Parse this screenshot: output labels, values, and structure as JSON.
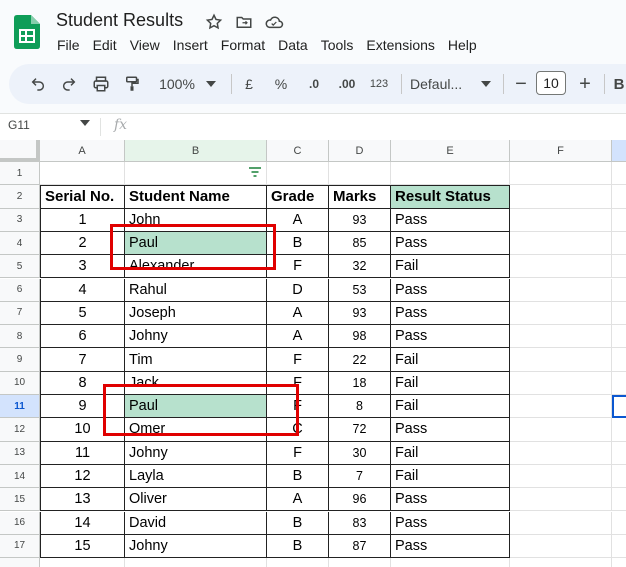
{
  "app": {
    "doc_title": "Student Results",
    "menu": [
      "File",
      "Edit",
      "View",
      "Insert",
      "Format",
      "Data",
      "Tools",
      "Extensions",
      "Help"
    ]
  },
  "toolbar": {
    "zoom": "100%",
    "currency": "£",
    "percent": "%",
    "dec_less": ".0",
    "dec_more": ".00",
    "number_format": "123",
    "font": "Defaul...",
    "font_size": "10",
    "bold": "B"
  },
  "formula_bar": {
    "name_box": "G11",
    "fx": "fx"
  },
  "columns": [
    "A",
    "B",
    "C",
    "D",
    "E",
    "F"
  ],
  "rows": [
    "1",
    "2",
    "3",
    "4",
    "5",
    "6",
    "7",
    "8",
    "9",
    "10",
    "11",
    "12",
    "13",
    "14",
    "15",
    "16",
    "17"
  ],
  "selected_row": "11",
  "table": {
    "headers": [
      "Serial No.",
      "Student Name",
      "Grade",
      "Marks",
      "Result Status"
    ],
    "data": [
      [
        "1",
        "John",
        "A",
        "93",
        "Pass"
      ],
      [
        "2",
        "Paul",
        "B",
        "85",
        "Pass"
      ],
      [
        "3",
        "Alexander",
        "F",
        "32",
        "Fail"
      ],
      [
        "4",
        "Rahul",
        "D",
        "53",
        "Pass"
      ],
      [
        "5",
        "Joseph",
        "A",
        "93",
        "Pass"
      ],
      [
        "6",
        "Johny",
        "A",
        "98",
        "Pass"
      ],
      [
        "7",
        "Tim",
        "F",
        "22",
        "Fail"
      ],
      [
        "8",
        "Jack",
        "F",
        "18",
        "Fail"
      ],
      [
        "9",
        "Paul",
        "F",
        "8",
        "Fail"
      ],
      [
        "10",
        "Omer",
        "C",
        "72",
        "Pass"
      ],
      [
        "11",
        "Johny",
        "F",
        "30",
        "Fail"
      ],
      [
        "12",
        "Layla",
        "B",
        "7",
        "Fail"
      ],
      [
        "13",
        "Oliver",
        "A",
        "96",
        "Pass"
      ],
      [
        "14",
        "David",
        "B",
        "83",
        "Pass"
      ],
      [
        "15",
        "Johny",
        "B",
        "87",
        "Pass"
      ]
    ]
  },
  "colors": {
    "highlight_green": "#b7e1cd",
    "header_green": "#b7e1cd",
    "red_box": "#e00000"
  }
}
